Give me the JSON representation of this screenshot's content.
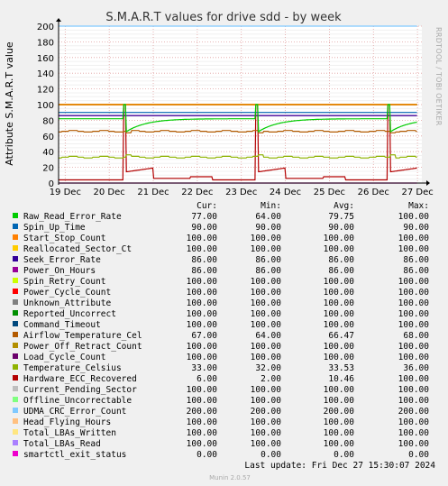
{
  "chart_data": {
    "type": "line",
    "title": "S.M.A.R.T values for drive sdd - by week",
    "ylabel": "Attribute S.M.A.R.T value",
    "ylim": [
      0,
      200
    ],
    "yticks": [
      "0",
      "20",
      "40",
      "60",
      "80",
      "100",
      "120",
      "140",
      "160",
      "180",
      "200"
    ],
    "xticks": [
      "19 Dec",
      "20 Dec",
      "21 Dec",
      "22 Dec",
      "23 Dec",
      "24 Dec",
      "25 Dec",
      "26 Dec",
      "27 Dec"
    ],
    "xrange_days": [
      -0.15,
      8.1
    ],
    "grid": true,
    "side_label": "RRDTOOL / TOBI OETIKER",
    "columns": [
      "Cur:",
      "Min:",
      "Avg:",
      "Max:"
    ],
    "series": [
      {
        "name": "Raw_Read_Error_Rate",
        "color": "#00cc00",
        "cur": "77.00",
        "min": "64.00",
        "avg": "79.75",
        "max": "100.00"
      },
      {
        "name": "Spin_Up_Time",
        "color": "#0066b3",
        "cur": "90.00",
        "min": "90.00",
        "avg": "90.00",
        "max": "90.00"
      },
      {
        "name": "Start_Stop_Count",
        "color": "#ff8000",
        "cur": "100.00",
        "min": "100.00",
        "avg": "100.00",
        "max": "100.00"
      },
      {
        "name": "Reallocated_Sector_Ct",
        "color": "#ffcc00",
        "cur": "100.00",
        "min": "100.00",
        "avg": "100.00",
        "max": "100.00"
      },
      {
        "name": "Seek_Error_Rate",
        "color": "#330099",
        "cur": "86.00",
        "min": "86.00",
        "avg": "86.00",
        "max": "86.00"
      },
      {
        "name": "Power_On_Hours",
        "color": "#990099",
        "cur": "86.00",
        "min": "86.00",
        "avg": "86.00",
        "max": "86.00"
      },
      {
        "name": "Spin_Retry_Count",
        "color": "#ccff00",
        "cur": "100.00",
        "min": "100.00",
        "avg": "100.00",
        "max": "100.00"
      },
      {
        "name": "Power_Cycle_Count",
        "color": "#ff0000",
        "cur": "100.00",
        "min": "100.00",
        "avg": "100.00",
        "max": "100.00"
      },
      {
        "name": "Unknown_Attribute",
        "color": "#808080",
        "cur": "100.00",
        "min": "100.00",
        "avg": "100.00",
        "max": "100.00"
      },
      {
        "name": "Reported_Uncorrect",
        "color": "#008f00",
        "cur": "100.00",
        "min": "100.00",
        "avg": "100.00",
        "max": "100.00"
      },
      {
        "name": "Command_Timeout",
        "color": "#00487d",
        "cur": "100.00",
        "min": "100.00",
        "avg": "100.00",
        "max": "100.00"
      },
      {
        "name": "Airflow_Temperature_Cel",
        "color": "#b35a00",
        "cur": "67.00",
        "min": "64.00",
        "avg": "66.47",
        "max": "68.00"
      },
      {
        "name": "Power_Off_Retract_Count",
        "color": "#b38f00",
        "cur": "100.00",
        "min": "100.00",
        "avg": "100.00",
        "max": "100.00"
      },
      {
        "name": "Load_Cycle_Count",
        "color": "#6b006b",
        "cur": "100.00",
        "min": "100.00",
        "avg": "100.00",
        "max": "100.00"
      },
      {
        "name": "Temperature_Celsius",
        "color": "#8fb300",
        "cur": "33.00",
        "min": "32.00",
        "avg": "33.53",
        "max": "36.00"
      },
      {
        "name": "Hardware_ECC_Recovered",
        "color": "#b30000",
        "cur": "6.00",
        "min": "2.00",
        "avg": "10.46",
        "max": "100.00"
      },
      {
        "name": "Current_Pending_Sector",
        "color": "#bebebe",
        "cur": "100.00",
        "min": "100.00",
        "avg": "100.00",
        "max": "100.00"
      },
      {
        "name": "Offline_Uncorrectable",
        "color": "#80ff80",
        "cur": "100.00",
        "min": "100.00",
        "avg": "100.00",
        "max": "100.00"
      },
      {
        "name": "UDMA_CRC_Error_Count",
        "color": "#80c9ff",
        "cur": "200.00",
        "min": "200.00",
        "avg": "200.00",
        "max": "200.00"
      },
      {
        "name": "Head_Flying_Hours",
        "color": "#ffc080",
        "cur": "100.00",
        "min": "100.00",
        "avg": "100.00",
        "max": "100.00"
      },
      {
        "name": "Total_LBAs_Written",
        "color": "#ffe680",
        "cur": "100.00",
        "min": "100.00",
        "avg": "100.00",
        "max": "100.00"
      },
      {
        "name": "Total_LBAs_Read",
        "color": "#aa80ff",
        "cur": "100.00",
        "min": "100.00",
        "avg": "100.00",
        "max": "100.00"
      },
      {
        "name": "smartctl_exit_status",
        "color": "#ee00cc",
        "cur": "0.00",
        "min": "0.00",
        "avg": "0.00",
        "max": "0.00"
      }
    ],
    "last_update": "Last update: Fri Dec 27 15:30:07 2024",
    "footer": "Munin 2.0.57"
  }
}
